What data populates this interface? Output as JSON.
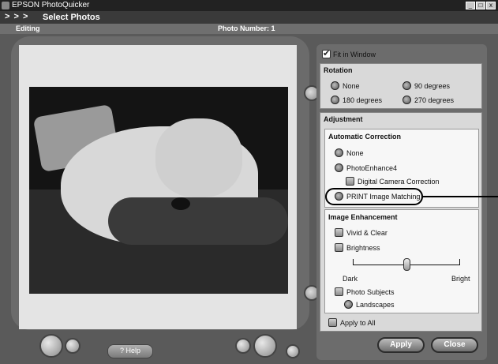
{
  "window": {
    "title": "EPSON PhotoQuicker",
    "controls": {
      "minimize": "_",
      "maximize": "□",
      "close": "x"
    }
  },
  "breadcrumb": {
    "arrows": "> > >",
    "label": "Select Photos"
  },
  "header": {
    "section": "Editing",
    "photo_number": "Photo Number: 1"
  },
  "nav": {
    "help_label": "? Help"
  },
  "settings": {
    "fit_in_window": {
      "label": "Fit in Window",
      "checked": true
    },
    "rotation": {
      "title": "Rotation",
      "options": [
        "None",
        "90 degrees",
        "180 degrees",
        "270 degrees"
      ]
    },
    "adjustment": {
      "title": "Adjustment",
      "automatic_correction": {
        "title": "Automatic Correction",
        "none": "None",
        "photoenhance": "PhotoEnhance4",
        "digital_camera": "Digital Camera Correction",
        "print_image_matching": "PRINT Image Matching"
      },
      "image_enhancement": {
        "title": "Image Enhancement",
        "vivid": "Vivid & Clear",
        "brightness": "Brightness",
        "dark": "Dark",
        "bright": "Bright",
        "brightness_level": 0.5,
        "photo_subjects": "Photo Subjects",
        "landscapes": "Landscapes"
      }
    },
    "apply_to_all": "Apply to All"
  },
  "buttons": {
    "apply": "Apply",
    "close": "Close"
  }
}
